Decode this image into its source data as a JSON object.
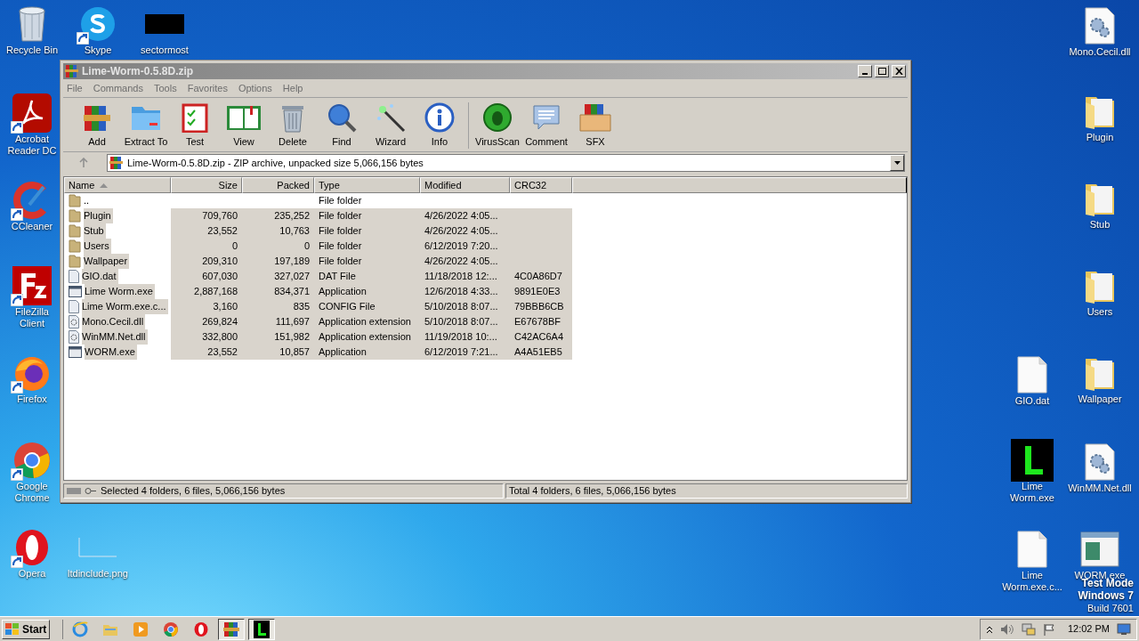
{
  "desktop_icons": [
    {
      "label": "Recycle Bin",
      "kind": "recycle",
      "shortcut": false
    },
    {
      "label": "Skype",
      "kind": "skype",
      "shortcut": true
    },
    {
      "label": "sectormost",
      "kind": "blackbox",
      "shortcut": false
    },
    {
      "label": "Acrobat Reader DC",
      "kind": "acrobat",
      "shortcut": true
    },
    {
      "label": "CCleaner",
      "kind": "ccleaner",
      "shortcut": true
    },
    {
      "label": "FileZilla Client",
      "kind": "filezilla",
      "shortcut": true
    },
    {
      "label": "Firefox",
      "kind": "firefox",
      "shortcut": true
    },
    {
      "label": "Google Chrome",
      "kind": "chrome",
      "shortcut": true
    },
    {
      "label": "Opera",
      "kind": "opera",
      "shortcut": true
    },
    {
      "label": "ltdinclude.png",
      "kind": "image",
      "shortcut": false
    },
    {
      "label": "Mono.Cecil.dll",
      "kind": "dll",
      "shortcut": false
    },
    {
      "label": "Plugin",
      "kind": "folder",
      "shortcut": false
    },
    {
      "label": "Stub",
      "kind": "folder",
      "shortcut": false
    },
    {
      "label": "Users",
      "kind": "folder",
      "shortcut": false
    },
    {
      "label": "GIO.dat",
      "kind": "file",
      "shortcut": false
    },
    {
      "label": "Wallpaper",
      "kind": "folder",
      "shortcut": false
    },
    {
      "label": "Lime Worm.exe",
      "kind": "lime",
      "shortcut": false
    },
    {
      "label": "WinMM.Net.dll",
      "kind": "dll",
      "shortcut": false
    },
    {
      "label": "Lime Worm.exe.c...",
      "kind": "file",
      "shortcut": false
    },
    {
      "label": "WORM.exe",
      "kind": "exewin",
      "shortcut": false
    }
  ],
  "window": {
    "title": "Lime-Worm-0.5.8D.zip",
    "menu": [
      "File",
      "Commands",
      "Tools",
      "Favorites",
      "Options",
      "Help"
    ],
    "toolbar": [
      {
        "label": "Add",
        "kind": "add"
      },
      {
        "label": "Extract To",
        "kind": "extract"
      },
      {
        "label": "Test",
        "kind": "test"
      },
      {
        "label": "View",
        "kind": "view"
      },
      {
        "label": "Delete",
        "kind": "delete"
      },
      {
        "label": "Find",
        "kind": "find"
      },
      {
        "label": "Wizard",
        "kind": "wizard"
      },
      {
        "label": "Info",
        "kind": "info"
      },
      {
        "label": "VirusScan",
        "kind": "virus"
      },
      {
        "label": "Comment",
        "kind": "comment"
      },
      {
        "label": "SFX",
        "kind": "sfx"
      }
    ],
    "address": "Lime-Worm-0.5.8D.zip - ZIP archive, unpacked size 5,066,156 bytes",
    "columns": [
      {
        "label": "Name",
        "sorted": true
      },
      {
        "label": "Size",
        "sorted": false
      },
      {
        "label": "Packed",
        "sorted": false
      },
      {
        "label": "Type",
        "sorted": false
      },
      {
        "label": "Modified",
        "sorted": false
      },
      {
        "label": "CRC32",
        "sorted": false
      }
    ],
    "rows": [
      {
        "name": "..",
        "size": "",
        "packed": "",
        "type": "File folder",
        "modified": "",
        "crc": "",
        "kind": "folder",
        "selected": false
      },
      {
        "name": "Plugin",
        "size": "709,760",
        "packed": "235,252",
        "type": "File folder",
        "modified": "4/26/2022 4:05...",
        "crc": "",
        "kind": "folder",
        "selected": true
      },
      {
        "name": "Stub",
        "size": "23,552",
        "packed": "10,763",
        "type": "File folder",
        "modified": "4/26/2022 4:05...",
        "crc": "",
        "kind": "folder",
        "selected": true
      },
      {
        "name": "Users",
        "size": "0",
        "packed": "0",
        "type": "File folder",
        "modified": "6/12/2019 7:20...",
        "crc": "",
        "kind": "folder",
        "selected": true
      },
      {
        "name": "Wallpaper",
        "size": "209,310",
        "packed": "197,189",
        "type": "File folder",
        "modified": "4/26/2022 4:05...",
        "crc": "",
        "kind": "folder",
        "selected": true
      },
      {
        "name": "GIO.dat",
        "size": "607,030",
        "packed": "327,027",
        "type": "DAT File",
        "modified": "11/18/2018 12:...",
        "crc": "4C0A86D7",
        "kind": "file",
        "selected": true
      },
      {
        "name": "Lime Worm.exe",
        "size": "2,887,168",
        "packed": "834,371",
        "type": "Application",
        "modified": "12/6/2018 4:33...",
        "crc": "9891E0E3",
        "kind": "exe",
        "selected": true
      },
      {
        "name": "Lime Worm.exe.c...",
        "size": "3,160",
        "packed": "835",
        "type": "CONFIG File",
        "modified": "5/10/2018 8:07...",
        "crc": "79BBB6CB",
        "kind": "file",
        "selected": true
      },
      {
        "name": "Mono.Cecil.dll",
        "size": "269,824",
        "packed": "111,697",
        "type": "Application extension",
        "modified": "5/10/2018 8:07...",
        "crc": "E67678BF",
        "kind": "dll",
        "selected": true
      },
      {
        "name": "WinMM.Net.dll",
        "size": "332,800",
        "packed": "151,982",
        "type": "Application extension",
        "modified": "11/19/2018 10:...",
        "crc": "C42AC6A4",
        "kind": "dll",
        "selected": true
      },
      {
        "name": "WORM.exe",
        "size": "23,552",
        "packed": "10,857",
        "type": "Application",
        "modified": "6/12/2019 7:21...",
        "crc": "A4A51EB5",
        "kind": "exe",
        "selected": true
      }
    ],
    "status_left": "Selected 4 folders, 6 files, 5,066,156 bytes",
    "status_right": "Total 4 folders, 6 files, 5,066,156 bytes"
  },
  "test_mode": [
    "Test Mode",
    "Windows 7",
    "Build 7601"
  ],
  "taskbar": {
    "start": "Start",
    "items": [
      {
        "kind": "ie",
        "active": false
      },
      {
        "kind": "explorer",
        "active": false
      },
      {
        "kind": "media",
        "active": false
      },
      {
        "kind": "chrome",
        "active": false
      },
      {
        "kind": "opera",
        "active": false
      },
      {
        "kind": "winrar",
        "active": true
      },
      {
        "kind": "lime",
        "active": true
      }
    ],
    "clock": "12:02 PM"
  }
}
